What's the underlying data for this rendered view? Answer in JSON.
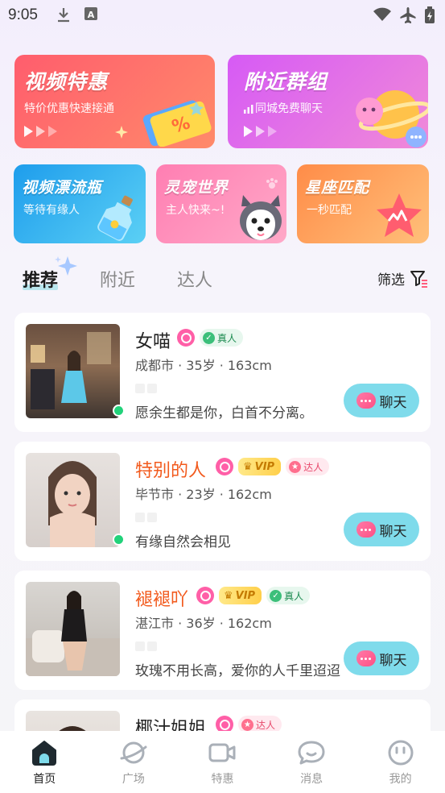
{
  "status_bar": {
    "time": "9:05",
    "icons": [
      "download-icon",
      "text-a-icon",
      "wifi-icon",
      "airplane-mode-icon",
      "battery-charging-icon"
    ]
  },
  "banners": [
    {
      "title": "视频特惠",
      "subtitle": "特价优惠快速接通",
      "icon": "ticket-percent-icon",
      "color": "#ff6a72"
    },
    {
      "title": "附近群组",
      "subtitle": "同城免费聊天",
      "icon": "planet-chat-icon",
      "color": "#e46bf5"
    },
    {
      "title": "视频漂流瓶",
      "subtitle": "等待有缘人",
      "icon": "message-bottle-icon",
      "color": "#2fb0ef"
    },
    {
      "title": "灵宠世界",
      "subtitle": "主人快来~!",
      "icon": "husky-dog-icon",
      "color": "#ff86b3"
    },
    {
      "title": "星座匹配",
      "subtitle": "一秒匹配",
      "icon": "star-match-icon",
      "color": "#ffa257"
    }
  ],
  "tabs": [
    "推荐",
    "附近",
    "达人"
  ],
  "filter_label": "筛选",
  "users": [
    {
      "name": "女喵",
      "name_color": "dark",
      "real_badge": "真人",
      "vip": "",
      "talent_badge": "",
      "meta": "成都市 · 35岁 · 163cm",
      "signature": "愿余生都是你，白首不分离。",
      "online": true
    },
    {
      "name": "特别的人",
      "name_color": "red",
      "real_badge": "",
      "vip": "VIP",
      "talent_badge": "达人",
      "meta": "毕节市 · 23岁 · 162cm",
      "signature": "有缘自然会相见",
      "online": true
    },
    {
      "name": "褪褪吖",
      "name_color": "red",
      "real_badge": "真人",
      "vip": "VIP",
      "talent_badge": "",
      "meta": "湛江市 · 36岁 · 162cm",
      "signature": "玫瑰不用长高，爱你的人千里迢迢",
      "online": false
    },
    {
      "name": "椰汁姐姐",
      "name_color": "dark",
      "real_badge": "",
      "vip": "",
      "talent_badge": "达人",
      "meta": "",
      "signature": "",
      "online": false
    }
  ],
  "chat_label": "聊天",
  "bottom_nav": [
    {
      "label": "首页",
      "icon": "home-icon",
      "active": true
    },
    {
      "label": "广场",
      "icon": "planet-icon",
      "active": false
    },
    {
      "label": "特惠",
      "icon": "video-camera-icon",
      "active": false
    },
    {
      "label": "消息",
      "icon": "message-icon",
      "active": false
    },
    {
      "label": "我的",
      "icon": "profile-icon",
      "active": false
    }
  ]
}
